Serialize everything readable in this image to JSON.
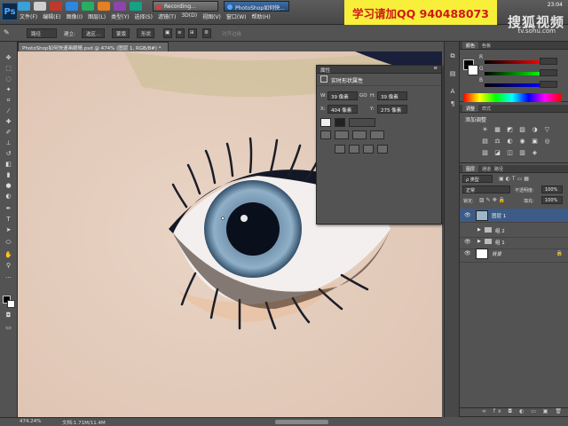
{
  "menubar": {
    "logo": "Ps",
    "items": [
      "文件(F)",
      "编辑(E)",
      "图像(I)",
      "图层(L)",
      "类型(Y)",
      "选择(S)",
      "滤镜(T)",
      "3D(D)",
      "视图(V)",
      "窗口(W)",
      "帮助(H)"
    ],
    "tabs": [
      {
        "label": "Recording...",
        "color": "#d04040"
      },
      {
        "label": "PhotoShop如何快...",
        "color": "#1c4e8a"
      }
    ],
    "promo": "学习请加QQ 940488073",
    "clock": "23:04"
  },
  "options": {
    "mode": "路径",
    "make_label": "建立:",
    "selection_btn": "选区...",
    "mask_btn": "蒙版",
    "shape_btn": "形状",
    "align_label": "对齐边缘"
  },
  "watermark": {
    "line1": "搜狐视频",
    "line2": "tv.sohu.com"
  },
  "document": {
    "tab_title": "PhotoShop如何快速画眼睛.psd @ 474% (图层 1, RGB/8#) *",
    "zoom": "474.24%",
    "doc_info": "文档:1.71M/11.4M"
  },
  "properties": {
    "title": "属性",
    "subtitle": "实时形状属性",
    "w_label": "W:",
    "w_value": "39 像素",
    "link": "GO",
    "h_label": "H:",
    "h_value": "39 像素",
    "x_label": "X:",
    "x_value": "404 像素",
    "y_label": "Y:",
    "y_value": "275 像素"
  },
  "color_panel": {
    "tabs": [
      "颜色",
      "色板"
    ],
    "r_label": "R",
    "g_label": "G",
    "b_label": "B",
    "r_value": "",
    "g_value": "",
    "b_value": "",
    "foreground": "#000000",
    "background": "#ffffff"
  },
  "adjust_panel": {
    "tabs": [
      "调整",
      "样式"
    ],
    "heading": "添加调整",
    "row1": [
      "☀",
      "▦",
      "◩",
      "▨",
      "◑",
      "▽"
    ],
    "row2": [
      "▤",
      "⚖",
      "◐",
      "◉",
      "▣",
      "◎"
    ],
    "row3": [
      "▧",
      "◪",
      "◫",
      "▥",
      "◈"
    ]
  },
  "layers_panel": {
    "tabs": [
      "图层",
      "通道",
      "路径"
    ],
    "filter": "ρ 类型",
    "blend_mode": "正常",
    "opacity_label": "不透明度:",
    "opacity": "100%",
    "lock_label": "锁定:",
    "fill_label": "填充:",
    "fill": "100%",
    "layers": [
      {
        "name": "图层 1",
        "selected": true,
        "type": "shape"
      },
      {
        "name": "组 2",
        "selected": false,
        "type": "group"
      },
      {
        "name": "组 1",
        "selected": false,
        "type": "group"
      },
      {
        "name": "背景",
        "selected": false,
        "type": "background"
      }
    ]
  }
}
